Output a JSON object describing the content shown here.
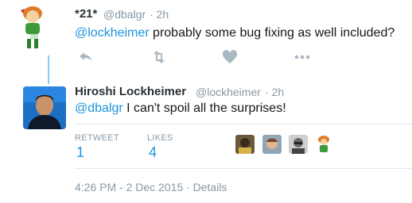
{
  "tweet1": {
    "name": "*21*",
    "handle": "@dbalgr",
    "time": "· 2h",
    "mention": "@lockheimer",
    "text": " probably some bug fixing as well included?"
  },
  "actions": {
    "icons": [
      "reply-icon",
      "retweet-icon",
      "like-icon",
      "more-icon"
    ]
  },
  "tweet2": {
    "name": "Hiroshi Lockheimer",
    "handle": "@lockheimer",
    "time": "· 2h",
    "mention": "@dbalgr",
    "text": " I can't spoil all the surprises!"
  },
  "stats": {
    "retweet_label": "RETWEET",
    "retweet_count": "1",
    "likes_label": "LIKES",
    "likes_count": "4"
  },
  "footer": {
    "timestamp": "4:26 PM - 2 Dec 2015 · ",
    "details_link": "Details"
  },
  "colors": {
    "accent": "#1b95e0",
    "muted": "#8899a6",
    "text": "#14171a",
    "icon": "#aab8c2"
  }
}
